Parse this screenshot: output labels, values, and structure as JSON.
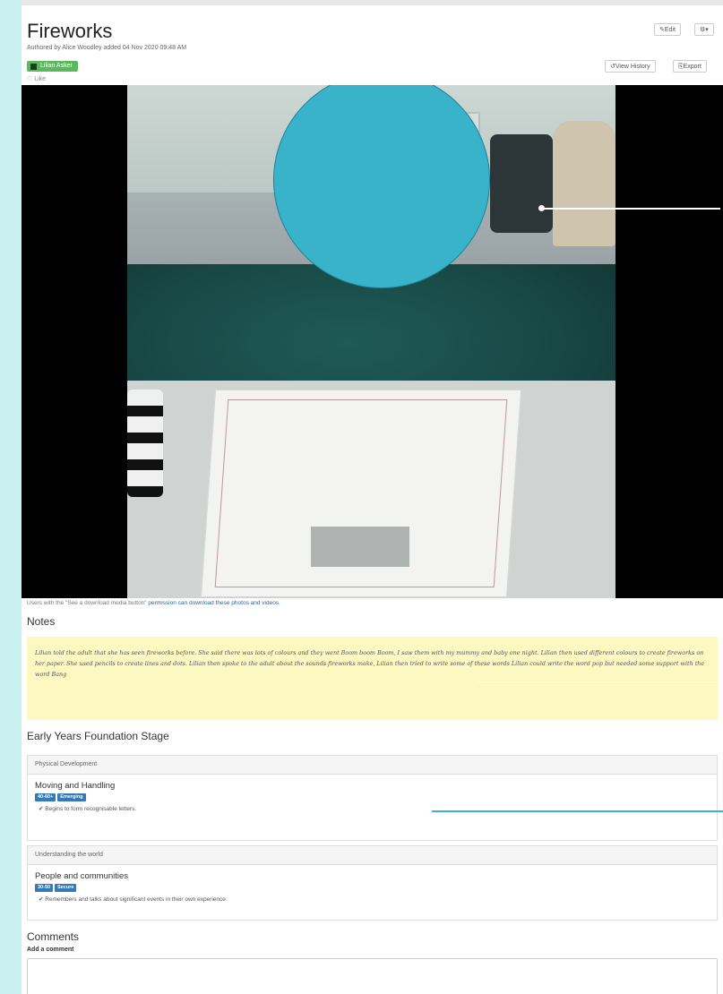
{
  "observation": {
    "title": "Fireworks",
    "authored": "Authored by Alice Woodley added 04 Nov 2020 09:48 AM",
    "child_tag": "Lilian Asker",
    "like_label": "Like",
    "buttons": {
      "edit": "✎Edit",
      "gear": "⚙▾",
      "view_history": "↺View History",
      "export": "⎘Export"
    }
  },
  "media": {
    "download_note_prefix": "Users with the \"See a download media button\"",
    "download_note_link": "permission",
    "download_note_suffix": "can download these photos and videos."
  },
  "notes": {
    "heading": "Notes",
    "text": "Lilian told the adult that she has seen fireworks before. She said there was lots of colours and they went Boom boom Boom, I saw them with my mummy and baby one night. Lilian then used different colours to create fireworks on her paper. She used pencils to create lines and dots. Lilian then spoke to the adult about the sounds fireworks make, Lilian then tried to write some of these words Lilian could write the word pop but needed some support with the word Bang"
  },
  "eyfs": {
    "heading": "Early Years Foundation Stage",
    "panels": [
      {
        "area": "Physical Development",
        "aspect": "Moving and Handling",
        "age": "40-60+",
        "level": "Emerging",
        "statement": "Begins to form recognisable letters."
      },
      {
        "area": "Understanding the world",
        "aspect": "People and communities",
        "age": "30-50",
        "level": "Secure",
        "statement": "Remembers and talks about significant events in their own experience."
      }
    ]
  },
  "comments": {
    "heading": "Comments",
    "add_label": "Add a comment"
  }
}
